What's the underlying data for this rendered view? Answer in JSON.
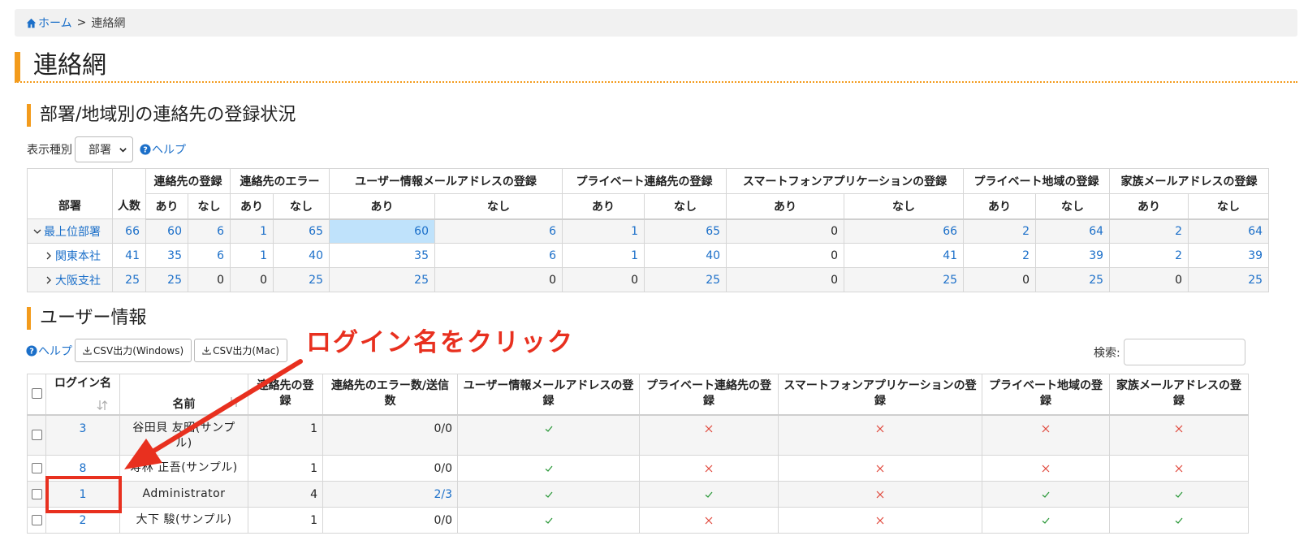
{
  "breadcrumb": {
    "home": "ホーム",
    "separator": ">",
    "current": "連絡網"
  },
  "page_title": "連絡網",
  "section1": {
    "title": "部署/地域別の連絡先の登録状況",
    "display_type_label": "表示種別",
    "display_type_value": "部署",
    "help": "ヘルプ"
  },
  "stats_table": {
    "dept_header": "部署",
    "count_header": "人数",
    "groups": [
      "連絡先の登録",
      "連絡先のエラー",
      "ユーザー情報メールアドレスの登録",
      "プライベート連絡先の登録",
      "スマートフォンアプリケーションの登録",
      "プライベート地域の登録",
      "家族メールアドレスの登録"
    ],
    "sub_yes": "あり",
    "sub_no": "なし",
    "rows": [
      {
        "expand": "open",
        "name": "最上位部署",
        "values": [
          "66",
          "60",
          "6",
          "1",
          "65",
          "60",
          "6",
          "1",
          "65",
          "0",
          "66",
          "2",
          "64",
          "2",
          "64"
        ]
      },
      {
        "expand": "closed",
        "name": "関東本社",
        "values": [
          "41",
          "35",
          "6",
          "1",
          "40",
          "35",
          "6",
          "1",
          "40",
          "0",
          "41",
          "2",
          "39",
          "2",
          "39"
        ]
      },
      {
        "expand": "closed",
        "name": "大阪支社",
        "values": [
          "25",
          "25",
          "0",
          "0",
          "25",
          "25",
          "0",
          "0",
          "25",
          "0",
          "25",
          "0",
          "25",
          "0",
          "25"
        ]
      }
    ]
  },
  "section2": {
    "title": "ユーザー情報",
    "help": "ヘルプ",
    "csv_windows": "CSV出力(Windows)",
    "csv_mac": "CSV出力(Mac)",
    "search_label": "検索:"
  },
  "users_table": {
    "headers": [
      "ログイン名",
      "名前",
      "連絡先の登録",
      "連絡先のエラー数/送信数",
      "ユーザー情報メールアドレスの登録",
      "プライベート連絡先の登録",
      "スマートフォンアプリケーションの登録",
      "プライベート地域の登録",
      "家族メールアドレスの登録"
    ],
    "rows": [
      {
        "login": "3",
        "name": "谷田貝 友昭(サンプル)",
        "contacts": "1",
        "errors": "0/0",
        "marks": [
          "check",
          "cross",
          "cross",
          "cross",
          "cross"
        ]
      },
      {
        "login": "8",
        "name": "寿林 正吾(サンプル)",
        "contacts": "1",
        "errors": "0/0",
        "marks": [
          "check",
          "cross",
          "cross",
          "cross",
          "cross"
        ]
      },
      {
        "login": "1",
        "name": "Administrator",
        "contacts": "4",
        "errors": "2/3",
        "marks": [
          "check",
          "check",
          "cross",
          "check",
          "check"
        ]
      },
      {
        "login": "2",
        "name": "大下 駿(サンプル)",
        "contacts": "1",
        "errors": "0/0",
        "marks": [
          "check",
          "cross",
          "cross",
          "check",
          "check"
        ]
      }
    ]
  },
  "annotation": {
    "text": "ログイン名をクリック"
  },
  "colors": {
    "accent": "#f39b1c",
    "link": "#1b6fc9",
    "check": "#2e9a3c",
    "cross": "#e0463a",
    "annotation": "#e8301f",
    "highlight": "#bfe2fb"
  }
}
